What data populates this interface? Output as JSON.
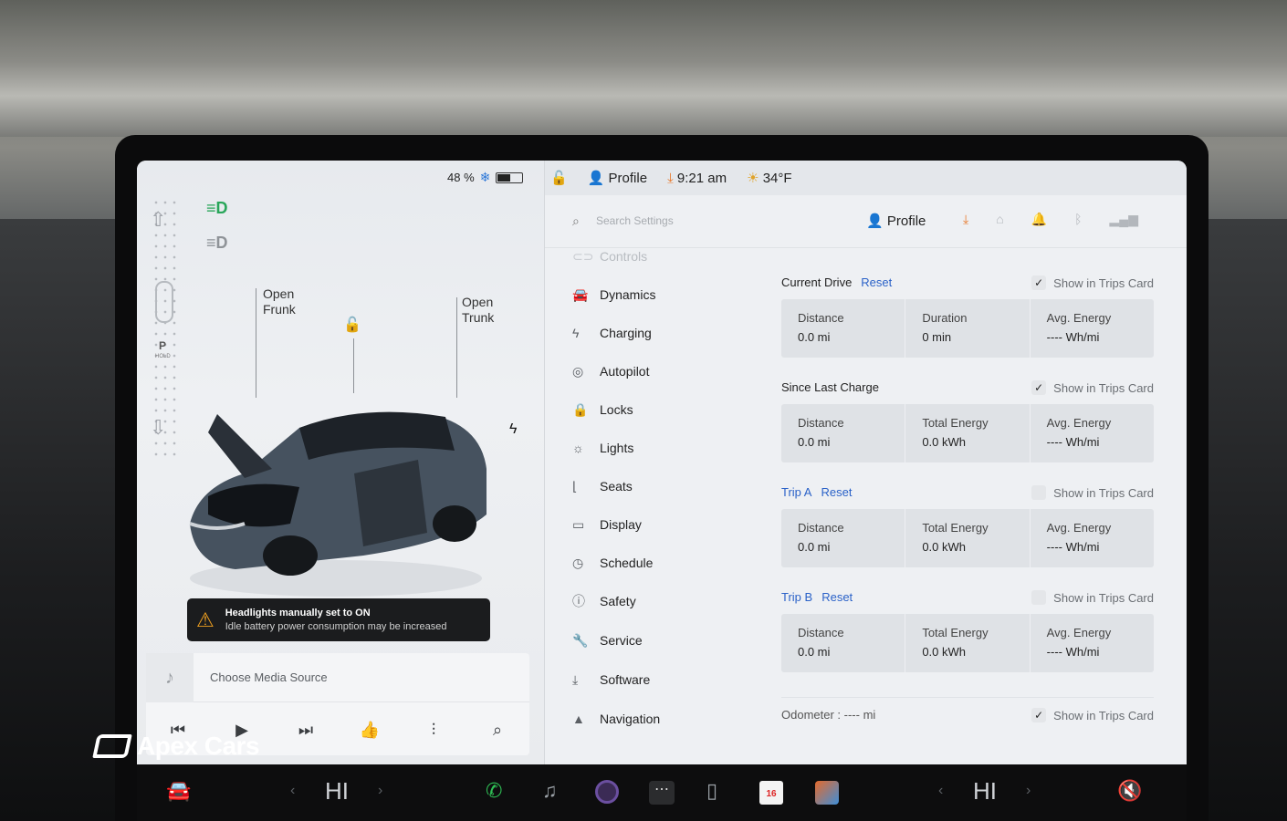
{
  "status_left": {
    "battery_percent_label": "48 %"
  },
  "topbar": {
    "profile": "Profile",
    "time": "9:21 am",
    "temperature": "34°F"
  },
  "car_panel": {
    "frunk_line1": "Open",
    "frunk_line2": "Frunk",
    "trunk_line1": "Open",
    "trunk_line2": "Trunk",
    "gear_p": "P",
    "gear_hold": "HOLD",
    "alert_title": "Headlights manually set to ON",
    "alert_subtitle": "Idle battery power consumption may be increased"
  },
  "media": {
    "source_label": "Choose Media Source"
  },
  "settings": {
    "search_placeholder": "Search Settings",
    "profile_label": "Profile",
    "nav": [
      {
        "label": "Controls",
        "icon": "toggle-icon"
      },
      {
        "label": "Dynamics",
        "icon": "car-icon"
      },
      {
        "label": "Charging",
        "icon": "bolt-icon"
      },
      {
        "label": "Autopilot",
        "icon": "steering-icon"
      },
      {
        "label": "Locks",
        "icon": "lock-icon"
      },
      {
        "label": "Lights",
        "icon": "light-icon"
      },
      {
        "label": "Seats",
        "icon": "seat-icon"
      },
      {
        "label": "Display",
        "icon": "display-icon"
      },
      {
        "label": "Schedule",
        "icon": "schedule-icon"
      },
      {
        "label": "Safety",
        "icon": "safety-icon"
      },
      {
        "label": "Service",
        "icon": "wrench-icon"
      },
      {
        "label": "Software",
        "icon": "download-icon"
      },
      {
        "label": "Navigation",
        "icon": "navigation-icon"
      }
    ],
    "trips": {
      "show_label": "Show in Trips Card",
      "reset_label": "Reset",
      "current_drive": {
        "title": "Current Drive",
        "cells": [
          {
            "label": "Distance",
            "value": "0.0  mi"
          },
          {
            "label": "Duration",
            "value": "0  min"
          },
          {
            "label": "Avg. Energy",
            "value": "----  Wh/mi"
          }
        ]
      },
      "since_last_charge": {
        "title": "Since Last Charge",
        "cells": [
          {
            "label": "Distance",
            "value": "0.0  mi"
          },
          {
            "label": "Total Energy",
            "value": "0.0  kWh"
          },
          {
            "label": "Avg. Energy",
            "value": "----  Wh/mi"
          }
        ]
      },
      "trip_a": {
        "title": "Trip A",
        "cells": [
          {
            "label": "Distance",
            "value": "0.0  mi"
          },
          {
            "label": "Total Energy",
            "value": "0.0  kWh"
          },
          {
            "label": "Avg. Energy",
            "value": "----  Wh/mi"
          }
        ]
      },
      "trip_b": {
        "title": "Trip B",
        "cells": [
          {
            "label": "Distance",
            "value": "0.0  mi"
          },
          {
            "label": "Total Energy",
            "value": "0.0  kWh"
          },
          {
            "label": "Avg. Energy",
            "value": "----  Wh/mi"
          }
        ]
      },
      "odometer": "Odometer  :  ----  mi"
    }
  },
  "dock": {
    "hi_left": "HI",
    "hi_right": "HI",
    "calendar_day": "16"
  },
  "watermark": {
    "text": "Apex Cars"
  },
  "colors": {
    "accent_blue": "#2b62c8",
    "download_orange": "#e8792b",
    "headlight_green": "#29a65a",
    "phone_green": "#2fbf55"
  }
}
